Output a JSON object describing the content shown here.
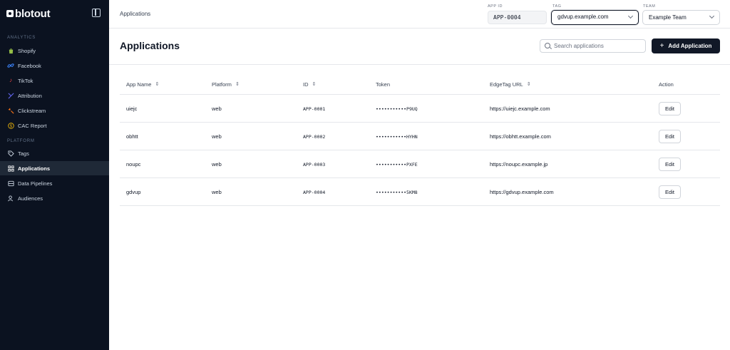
{
  "sidebar": {
    "brand": "blotout",
    "sections": [
      {
        "label": "ANALYTICS",
        "items": [
          {
            "label": "Shopify",
            "icon": "shopify-icon"
          },
          {
            "label": "Facebook",
            "icon": "meta-icon"
          },
          {
            "label": "TikTok",
            "icon": "tiktok-icon"
          },
          {
            "label": "Attribution",
            "icon": "attribution-icon"
          },
          {
            "label": "Clickstream",
            "icon": "clickstream-icon"
          },
          {
            "label": "CAC Report",
            "icon": "dollar-icon"
          }
        ]
      },
      {
        "label": "PLATFORM",
        "items": [
          {
            "label": "Tags",
            "icon": "tag-icon"
          },
          {
            "label": "Applications",
            "icon": "grid-icon",
            "active": true
          },
          {
            "label": "Data Pipelines",
            "icon": "database-icon"
          },
          {
            "label": "Audiences",
            "icon": "users-icon"
          }
        ]
      }
    ]
  },
  "header": {
    "breadcrumb": "Applications",
    "app_id_label": "APP ID",
    "app_id_value": "APP-0004",
    "tag_label": "TAG",
    "tag_value": "gdvup.example.com",
    "team_label": "TEAM",
    "team_value": "Example Team"
  },
  "main": {
    "title": "Applications",
    "search_placeholder": "Search applications",
    "add_button_label": "Add Application",
    "columns": [
      "App Name",
      "Platform",
      "ID",
      "Token",
      "EdgeTag URL",
      "Action"
    ],
    "rows": [
      {
        "name": "uiejc",
        "platform": "web",
        "id": "APP-0001",
        "token": "•••••••••••P9UQ",
        "url": "https://uiejc.example.com",
        "action": "Edit"
      },
      {
        "name": "obhtt",
        "platform": "web",
        "id": "APP-0002",
        "token": "•••••••••••HYHN",
        "url": "https://obhtt.example.com",
        "action": "Edit"
      },
      {
        "name": "noupc",
        "platform": "web",
        "id": "APP-0003",
        "token": "•••••••••••PXFE",
        "url": "https://noupc.example.jp",
        "action": "Edit"
      },
      {
        "name": "gdvup",
        "platform": "web",
        "id": "APP-0004",
        "token": "•••••••••••5KM8",
        "url": "https://gdvup.example.com",
        "action": "Edit"
      }
    ]
  },
  "colors": {
    "sidebar_bg": "#0b1220",
    "active_item_bg": "#1f2937",
    "primary_button": "#111827",
    "shopify": "#95bf47",
    "meta": "#3b82f6",
    "tiktok": "#ef4444",
    "attribution": "#6366f1",
    "clickstream": "#f97316",
    "cac": "#eab308"
  }
}
